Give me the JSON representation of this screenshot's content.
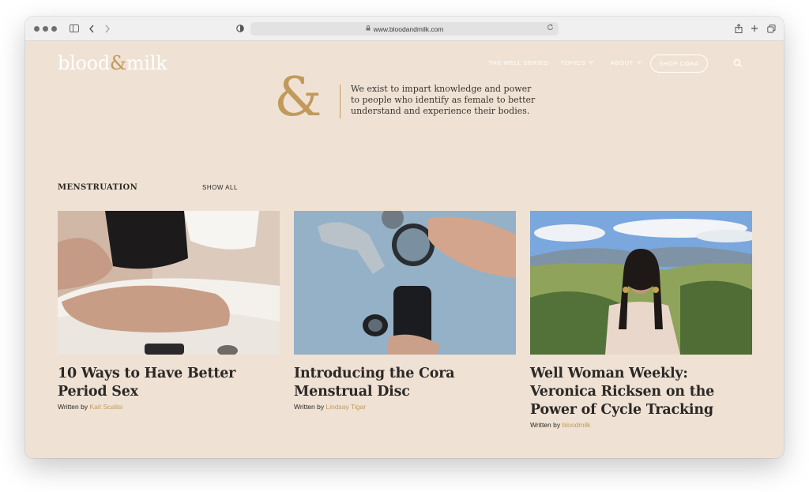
{
  "browser": {
    "url": "www.bloodandmilk.com",
    "icons": [
      "sidebar-icon",
      "back-icon",
      "forward-icon",
      "shield-icon",
      "lock-icon",
      "reload-icon",
      "share-icon",
      "new-tab-icon",
      "tabs-icon"
    ]
  },
  "header": {
    "logo_left": "blood",
    "logo_amp": "&",
    "logo_right": "milk",
    "nav": {
      "well_series": "THE WELL SERIES",
      "topics": "TOPICS",
      "about": "ABOUT",
      "shop": "SHOP CORA"
    }
  },
  "hero": {
    "ampersand": "&",
    "text": "We exist to impart knowledge and power to people who identify as female to better understand and experience their bodies."
  },
  "section": {
    "title": "MENSTRUATION",
    "show_all": "SHOW ALL"
  },
  "articles": [
    {
      "title": "10 Ways to Have Better Period Sex",
      "written_by": "Written by",
      "author": "Kait Scalisi"
    },
    {
      "title": "Introducing the Cora Menstrual Disc",
      "written_by": "Written by",
      "author": "Lindsay Tigar"
    },
    {
      "title": "Well Woman Weekly: Veronica Ricksen on the Power of Cycle Tracking",
      "written_by": "Written by",
      "author": "bloodmilk"
    }
  ],
  "colors": {
    "page_bg": "#efe2d4",
    "accent_gold": "#c19a5b",
    "text_dark": "#2c2826"
  }
}
